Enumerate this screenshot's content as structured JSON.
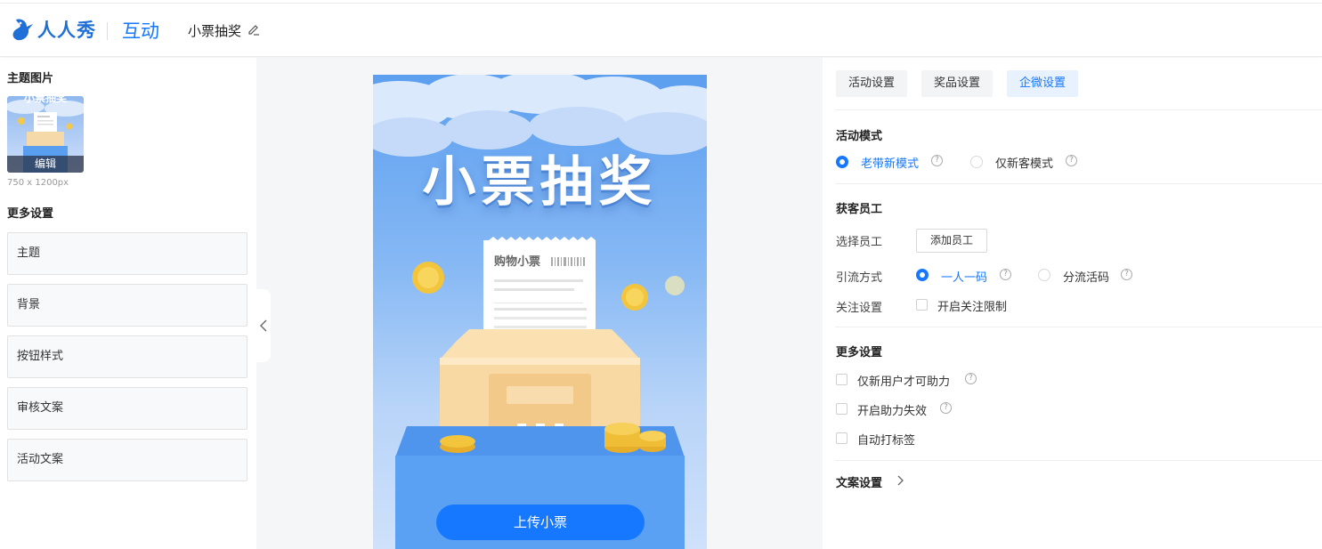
{
  "header": {
    "logo_text": "人人秀",
    "section": "互动",
    "title": "小票抽奖"
  },
  "left": {
    "theme_image_title": "主题图片",
    "thumb_edit": "编辑",
    "thumb_size": "750 x 1200px",
    "more_settings_title": "更多设置",
    "items": [
      "主题",
      "背景",
      "按钮样式",
      "审核文案",
      "活动文案"
    ]
  },
  "preview": {
    "title": "小票抽奖",
    "receipt_title": "购物小票",
    "button": "上传小票"
  },
  "right": {
    "tabs": [
      "活动设置",
      "奖品设置",
      "企微设置"
    ],
    "active_tab": "企微设置",
    "mode": {
      "title": "活动模式",
      "options": [
        "老带新模式",
        "仅新客模式"
      ],
      "selected": "老带新模式"
    },
    "staff": {
      "title": "获客员工",
      "select_label": "选择员工",
      "add_button": "添加员工",
      "traffic_label": "引流方式",
      "traffic_options": [
        "一人一码",
        "分流活码"
      ],
      "traffic_selected": "一人一码",
      "follow_label": "关注设置",
      "follow_option": "开启关注限制"
    },
    "more": {
      "title": "更多设置",
      "options": [
        "仅新用户才可助力",
        "开启助力失效",
        "自动打标签"
      ]
    },
    "copy_settings": "文案设置"
  },
  "colors": {
    "accent": "#1677ff",
    "brand": "#1f6fd8"
  }
}
